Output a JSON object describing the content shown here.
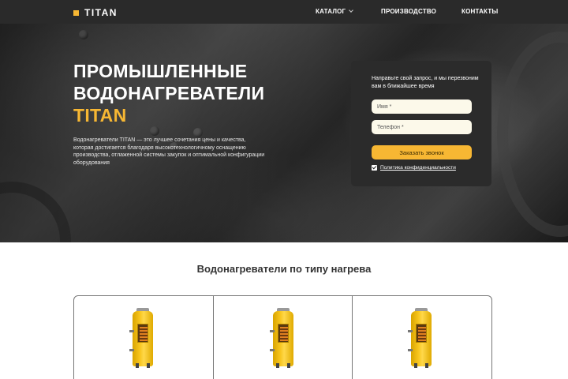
{
  "header": {
    "logo_text": "TITAN",
    "nav": {
      "catalog": "КАТАЛОГ",
      "production": "ПРОИЗВОДСТВО",
      "contacts": "КОНТАКТЫ"
    }
  },
  "hero": {
    "title_line1": "ПРОМЫШЛЕННЫЕ",
    "title_line2": "ВОДОНАГРЕВАТЕЛИ",
    "title_accent": "TITAN",
    "description": "Водонагреватели TITAN — это лучшее сочетания цены и качества, которая достигается благодаря высокотехнологичному оснащению производства, отлаженной системы закупок и оптимальной конфигурации оборудования"
  },
  "form": {
    "caption": "Направьте свой запрос, и мы перезвоним вам в ближайшее время",
    "name_placeholder": "Имя *",
    "phone_placeholder": "Телефон *",
    "submit_label": "Заказать звонок",
    "privacy_label": "Политика конфиденциальности",
    "privacy_checked": true
  },
  "section": {
    "title": "Водонагреватели по типу нагрева"
  },
  "colors": {
    "accent": "#f7b733",
    "header_bg": "#2a2a2a",
    "form_bg": "#2b2b2b"
  },
  "icons": {
    "logo": "square-logo-mark",
    "catalog_dropdown": "chevron-down-icon",
    "privacy_checkbox": "checkbox-checked-icon",
    "product_image": "water-heater-image"
  }
}
